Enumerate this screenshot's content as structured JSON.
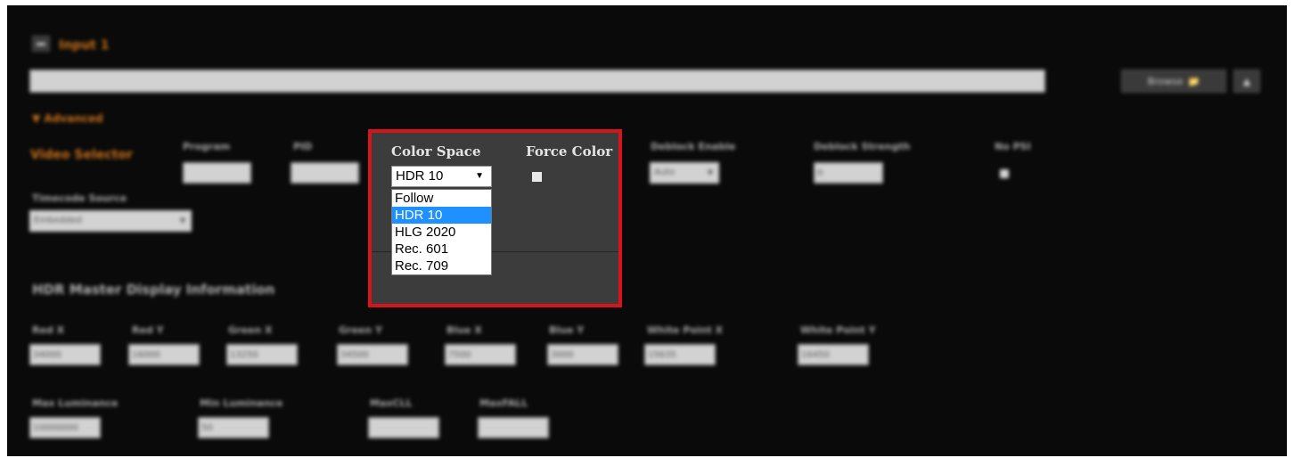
{
  "input": {
    "title": "Input 1",
    "collapse_icon": "minus-icon",
    "browse_label": "Browse",
    "browse_icon": "folder-icon",
    "upload_icon": "upload-icon",
    "advanced_label": "Advanced"
  },
  "video_selector": {
    "label": "Video Selector",
    "program_label": "Program",
    "pid_label": "PID",
    "deblock_enable_label": "Deblock Enable",
    "deblock_enable_value": "Auto",
    "deblock_strength_label": "Deblock Strength",
    "deblock_strength_value": "0",
    "no_psi_label": "No PSI",
    "timecode_source_label": "Timecode Source",
    "timecode_source_value": "Embedded"
  },
  "color": {
    "color_space_label": "Color Space",
    "color_space_selected": "HDR 10",
    "options": [
      "Follow",
      "HDR 10",
      "HLG 2020",
      "Rec. 601",
      "Rec. 709"
    ],
    "selected_index": 1,
    "force_color_label": "Force Color",
    "highlight_color": "#d8141a",
    "option_highlight": "#1e90ff"
  },
  "hdr": {
    "section_title": "HDR Master Display Information",
    "red_x_label": "Red X",
    "red_x": "34000",
    "red_y_label": "Red Y",
    "red_y": "16000",
    "green_x_label": "Green X",
    "green_x": "13250",
    "green_y_label": "Green Y",
    "green_y": "34500",
    "blue_x_label": "Blue X",
    "blue_x": "7500",
    "blue_y_label": "Blue Y",
    "blue_y": "3000",
    "white_x_label": "White Point X",
    "white_x": "15635",
    "white_y_label": "White Point Y",
    "white_y": "16450",
    "max_lum_label": "Max Luminance",
    "max_lum": "10000000",
    "min_lum_label": "Min Luminance",
    "min_lum": "50",
    "maxcll_label": "MaxCLL",
    "maxfall_label": "MaxFALL"
  }
}
